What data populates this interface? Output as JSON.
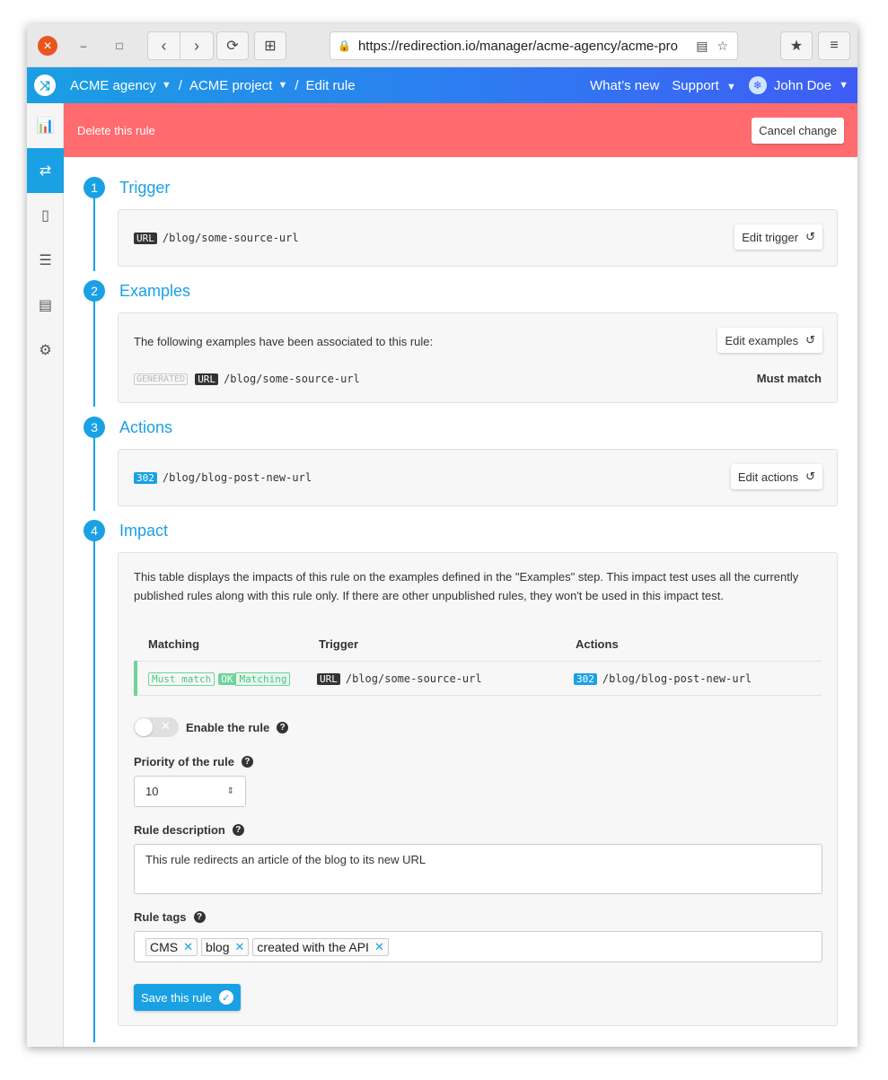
{
  "browser": {
    "url": "https://redirection.io/manager/acme-agency/acme-pro"
  },
  "header": {
    "agency": "ACME agency",
    "project": "ACME project",
    "sep1": "/",
    "sep2": "/",
    "page": "Edit rule",
    "whats_new": "What’s new",
    "support": "Support",
    "user": "John Doe"
  },
  "danger": {
    "delete_label": "Delete this rule",
    "cancel_label": "Cancel change"
  },
  "steps": [
    {
      "num": "1",
      "title": "Trigger"
    },
    {
      "num": "2",
      "title": "Examples"
    },
    {
      "num": "3",
      "title": "Actions"
    },
    {
      "num": "4",
      "title": "Impact"
    }
  ],
  "trigger": {
    "badge": "URL",
    "path": "/blog/some-source-url",
    "edit_label": "Edit trigger"
  },
  "examples": {
    "intro": "The following examples have been associated to this rule:",
    "generated_badge": "GENERATED",
    "url_badge": "URL",
    "path": "/blog/some-source-url",
    "status": "Must match",
    "edit_label": "Edit examples"
  },
  "actions": {
    "code": "302",
    "path": "/blog/blog-post-new-url",
    "edit_label": "Edit actions"
  },
  "impact": {
    "description": "This table displays the impacts of this rule on the examples defined in the \"Examples\" step. This impact test uses all the currently published rules along with this rule only. If there are other unpublished rules, they won't be used in this impact test.",
    "columns": [
      "Matching",
      "Trigger",
      "Actions"
    ],
    "row": {
      "must_match": "Must match",
      "ok": "OK",
      "matching": "Matching",
      "trigger_badge": "URL",
      "trigger_path": "/blog/some-source-url",
      "action_code": "302",
      "action_path": "/blog/blog-post-new-url"
    }
  },
  "form": {
    "enable_label": "Enable the rule",
    "enabled": false,
    "priority_label": "Priority of the rule",
    "priority_value": "10",
    "description_label": "Rule description",
    "description_value": "This rule redirects an article of the blog to its new URL",
    "tags_label": "Rule tags",
    "tags": [
      "CMS",
      "blog",
      "created with the API"
    ],
    "save_label": "Save this rule"
  },
  "colors": {
    "accent": "#1aa1e4",
    "danger": "#ff6b6f",
    "success": "#6fd39b"
  }
}
